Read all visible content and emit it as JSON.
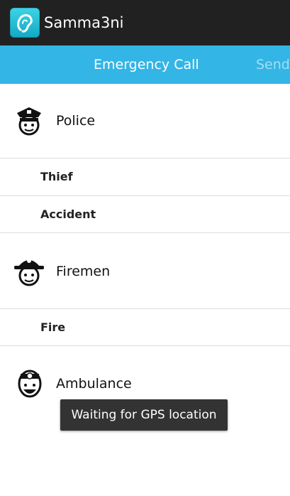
{
  "app": {
    "title": "Samma3ni",
    "icon": "ear-icon"
  },
  "tabs": [
    {
      "label": "Emergency Call",
      "active": true
    },
    {
      "label": "Send",
      "active": false
    }
  ],
  "list": {
    "groups": [
      {
        "label": "Police",
        "icon": "police-officer-icon",
        "items": [
          "Thief",
          "Accident"
        ]
      },
      {
        "label": "Firemen",
        "icon": "firefighter-icon",
        "items": [
          "Fire"
        ]
      },
      {
        "label": "Ambulance",
        "icon": "doctor-icon",
        "items": []
      }
    ]
  },
  "toast": {
    "text": "Waiting for GPS location"
  },
  "colors": {
    "actionbar": "#212121",
    "tabbar": "#33b5e5",
    "toast": "#333333"
  }
}
